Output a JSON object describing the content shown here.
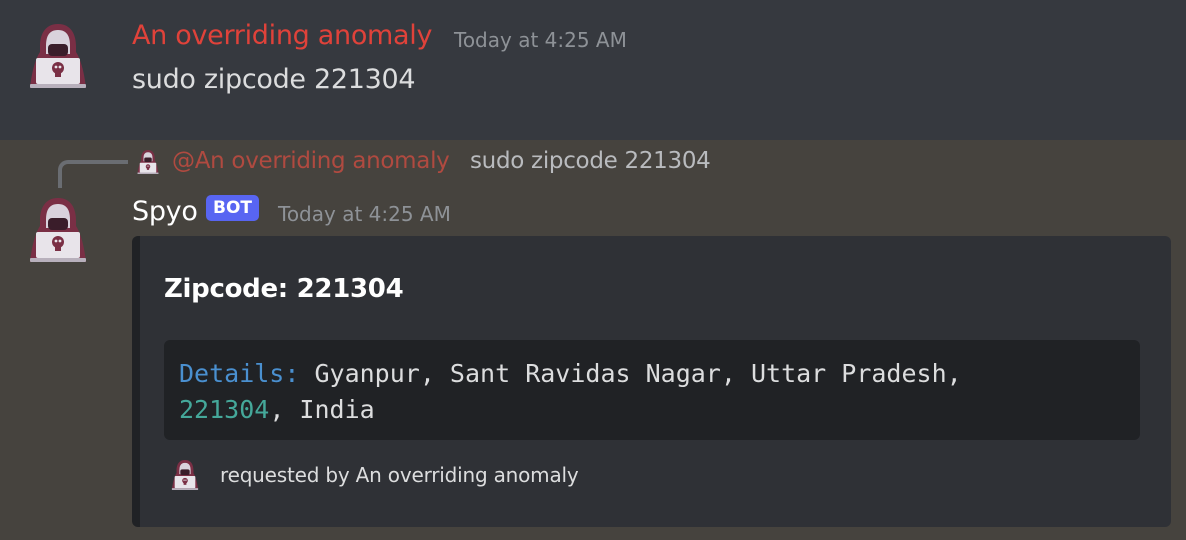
{
  "message1": {
    "author": "An overriding anomaly",
    "timestamp": "Today at 4:25 AM",
    "content": "sudo zipcode 221304",
    "avatar_icon": "hacker-avatar-icon"
  },
  "message2": {
    "reply": {
      "mention": "@An overriding anomaly",
      "text": "sudo zipcode 221304"
    },
    "author": "Spyo",
    "badge": "BOT",
    "timestamp": "Today at 4:25 AM",
    "avatar_icon": "hacker-avatar-icon",
    "embed": {
      "title": "Zipcode: 221304",
      "code": {
        "key": "Details:",
        "line1_value": " Gyanpur, Sant Ravidas Nagar, Uttar Pradesh,",
        "line2_number": "221304",
        "line2_value": ", India"
      },
      "footer": "requested by An overriding anomaly"
    }
  },
  "colors": {
    "background": "#36393f",
    "reply_background": "#46433e",
    "author_highlight": "#e0423a",
    "bot_badge": "#5865f2",
    "embed_background": "#2f3136",
    "code_key": "#4a90d0",
    "code_number": "#45a89a"
  }
}
